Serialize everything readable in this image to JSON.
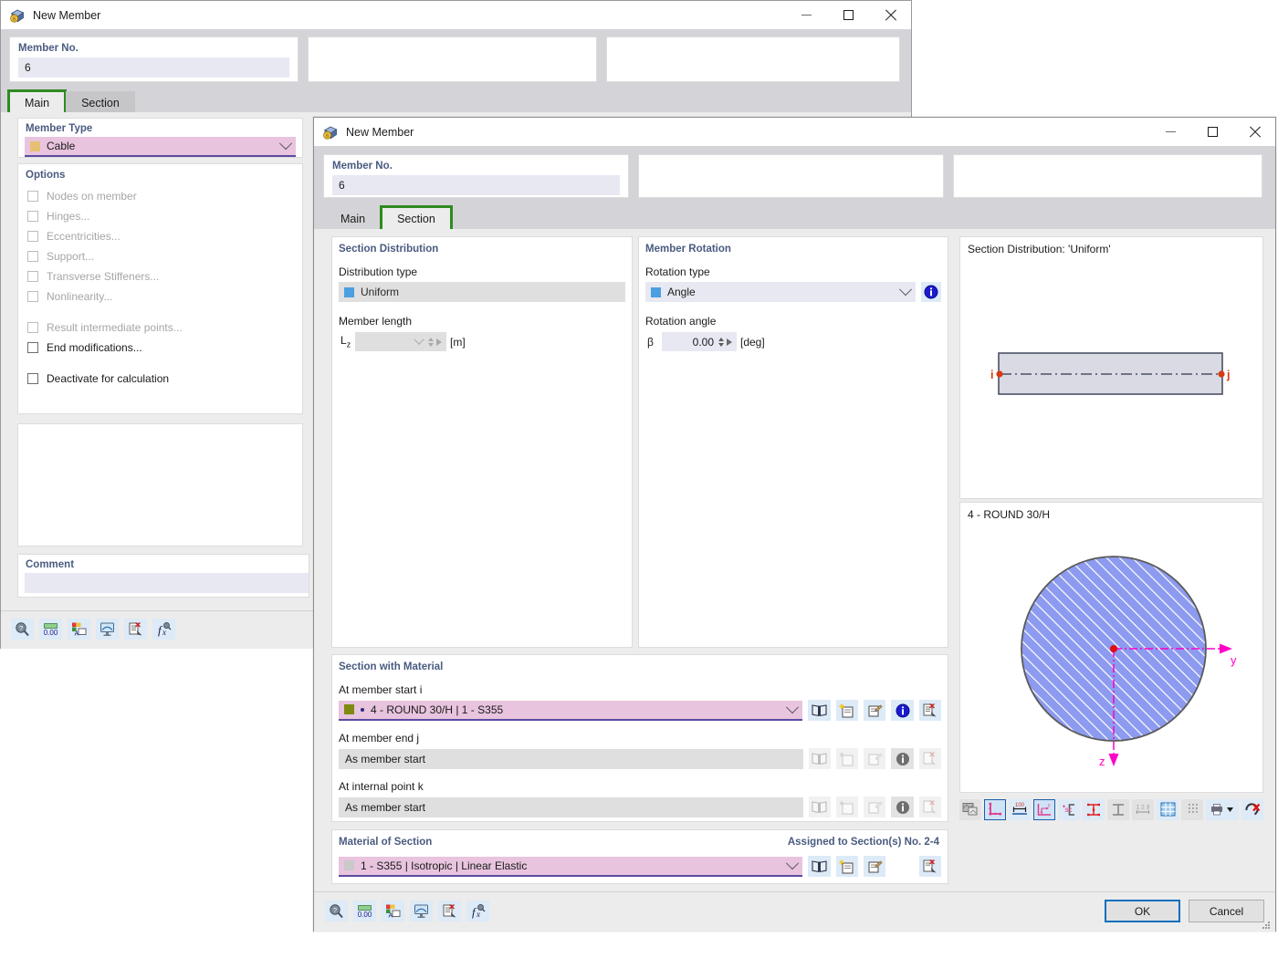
{
  "colors": {
    "accent_pink": "#e8c4de",
    "accent_underline": "#5b4ba0",
    "label_blue": "#4a5b80",
    "highlight_green": "#2e8b1f",
    "primary_blue": "#0a6ebd",
    "field_lavender": "#e8e8f3",
    "field_grey": "#dfdfdf",
    "section_fill": "#8c9aef",
    "axis_magenta": "#ff00c8",
    "node_red": "#d83a12"
  },
  "dialog_back": {
    "title": "New Member",
    "icon": "member-cube-icon",
    "window_buttons": [
      "minimize",
      "maximize",
      "close"
    ],
    "member_no": {
      "label": "Member No.",
      "value": "6"
    },
    "tabs": [
      {
        "label": "Main",
        "active": true,
        "highlighted": true
      },
      {
        "label": "Section",
        "active": false,
        "highlighted": false
      }
    ],
    "member_type": {
      "label": "Member Type",
      "value": "Cable",
      "swatch": "#e7bf73"
    },
    "options": {
      "label": "Options",
      "items": [
        {
          "label": "Nodes on member",
          "checked": false,
          "enabled": false
        },
        {
          "label": "Hinges...",
          "checked": false,
          "enabled": false
        },
        {
          "label": "Eccentricities...",
          "checked": false,
          "enabled": false
        },
        {
          "label": "Support...",
          "checked": false,
          "enabled": false
        },
        {
          "label": "Transverse Stiffeners...",
          "checked": false,
          "enabled": false
        },
        {
          "label": "Nonlinearity...",
          "checked": false,
          "enabled": false
        },
        {
          "label": "Result intermediate points...",
          "checked": false,
          "enabled": false
        },
        {
          "label": "End modifications...",
          "checked": false,
          "enabled": true
        },
        {
          "label": "Deactivate for calculation",
          "checked": false,
          "enabled": true
        }
      ]
    },
    "comment": {
      "label": "Comment",
      "value": ""
    },
    "toolbar": [
      "help-search-icon",
      "decimal-places-icon",
      "display-properties-icon",
      "view-mode-icon",
      "delete-doc-icon",
      "formula-icon"
    ]
  },
  "dialog_front": {
    "title": "New Member",
    "icon": "member-cube-icon",
    "window_buttons": [
      "minimize",
      "maximize",
      "close"
    ],
    "member_no": {
      "label": "Member No.",
      "value": "6"
    },
    "tabs": [
      {
        "label": "Main",
        "active": false,
        "highlighted": false
      },
      {
        "label": "Section",
        "active": true,
        "highlighted": true
      }
    ],
    "section_distribution": {
      "title": "Section Distribution",
      "distribution_type_label": "Distribution type",
      "distribution_type_value": "Uniform",
      "member_length_label": "Member length",
      "member_length_symbol": "L",
      "member_length_subscript": "z",
      "member_length_value": "",
      "member_length_unit": "[m]"
    },
    "member_rotation": {
      "title": "Member Rotation",
      "rotation_type_label": "Rotation type",
      "rotation_type_value": "Angle",
      "info_icon": "info-icon",
      "rotation_angle_label": "Rotation angle",
      "rotation_angle_symbol": "β",
      "rotation_angle_value": "0.00",
      "rotation_angle_unit": "[deg]"
    },
    "section_with_material": {
      "title": "Section with Material",
      "rows": [
        {
          "label": "At member start i",
          "value": "4 - ROUND 30/H | 1 - S355",
          "state": "active",
          "swatch": "#7f8a12",
          "bullet": true,
          "buttons": [
            "library-icon",
            "new-section-icon",
            "edit-section-icon",
            "info-icon",
            "delete-icon"
          ]
        },
        {
          "label": "At member end j",
          "value": "As member start",
          "state": "disabled",
          "buttons": [
            "library-icon",
            "new-section-icon",
            "edit-section-icon",
            "info-icon",
            "delete-icon"
          ]
        },
        {
          "label": "At internal point k",
          "value": "As member start",
          "state": "disabled",
          "buttons": [
            "library-icon",
            "new-section-icon",
            "edit-section-icon",
            "info-icon",
            "delete-icon"
          ]
        }
      ]
    },
    "material_of_section": {
      "title": "Material of Section",
      "assigned_note": "Assigned to Section(s) No. 2-4",
      "value": "1 - S355 | Isotropic | Linear Elastic",
      "swatch": "#c9c9c9",
      "buttons": [
        "library-icon",
        "new-material-icon",
        "edit-material-icon",
        "delete-icon"
      ]
    },
    "preview_top": {
      "caption": "Section Distribution: 'Uniform'",
      "node_start_label": "i",
      "node_end_label": "j"
    },
    "preview_bottom": {
      "caption": "4 - ROUND 30/H",
      "axis_y_label": "y",
      "axis_z_label": "z"
    },
    "preview_toolbar": [
      {
        "name": "render-icon",
        "state": "off"
      },
      {
        "name": "dimensions-corner-icon",
        "state": "sel"
      },
      {
        "name": "total-dimension-icon",
        "state": "on"
      },
      {
        "name": "axis-system-icon",
        "state": "sel"
      },
      {
        "name": "shear-center-icon",
        "state": "on"
      },
      {
        "name": "stiffener-dims-icon",
        "state": "on"
      },
      {
        "name": "profile-outline-icon",
        "state": "off"
      },
      {
        "name": "numbering-icon",
        "state": "off"
      },
      {
        "name": "grid-icon",
        "state": "on"
      },
      {
        "name": "points-icon",
        "state": "off"
      },
      {
        "name": "print-icon",
        "state": "on"
      },
      {
        "name": "clear-selection-icon",
        "state": "on"
      }
    ],
    "toolbar": [
      "help-search-icon",
      "decimal-places-icon",
      "display-properties-icon",
      "view-mode-icon",
      "delete-doc-icon",
      "formula-icon"
    ],
    "buttons": {
      "ok": "OK",
      "cancel": "Cancel"
    }
  }
}
